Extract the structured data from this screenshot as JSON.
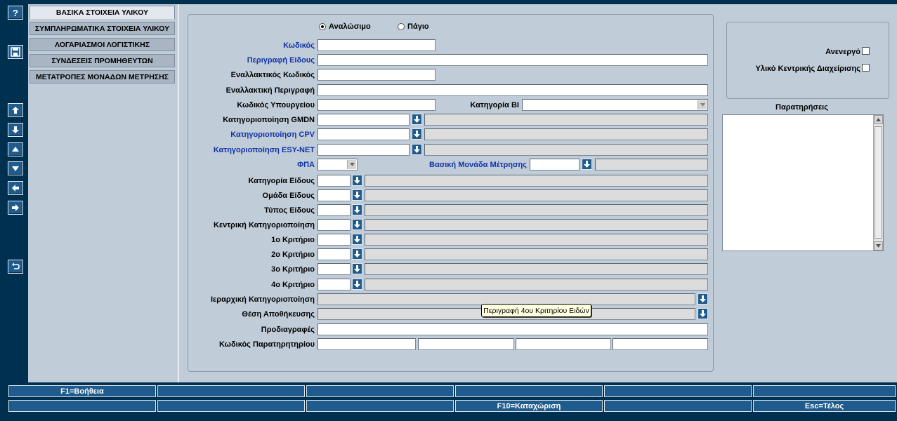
{
  "toolbar": {
    "help": "?",
    "icons": [
      "save-icon",
      "up-arrow-icon",
      "down-arrow-icon",
      "triangle-up-icon",
      "triangle-down-icon",
      "left-arrow-icon",
      "right-arrow-icon",
      "undo-icon"
    ]
  },
  "tabs": [
    "ΒΑΣΙΚΑ ΣΤΟΙΧΕΙΑ ΥΛΙΚΟΥ",
    "ΣΥΜΠΛΗΡΩΜΑΤΙΚΑ ΣΤΟΙΧΕΙΑ ΥΛΙΚΟΥ",
    "ΛΟΓΑΡΙΑΣΜΟΙ ΛΟΓΙΣΤΙΚΗΣ",
    "ΣΥΝΔΕΣΕΙΣ ΠΡΟΜΗΘΕΥΤΩΝ",
    "ΜΕΤΑΤΡΟΠΕΣ ΜΟΝΑΔΩΝ ΜΕΤΡΗΣΗΣ"
  ],
  "type": {
    "consumable": "Αναλώσιμο",
    "fixed": "Πάγιο",
    "selected": "Αναλώσιμο"
  },
  "form": {
    "code": "Κωδικός",
    "description": "Περιγραφή Είδους",
    "alt_code": "Εναλλακτικός Κωδικός",
    "alt_description": "Εναλλακτική Περιγραφή",
    "ministry_code": "Κωδικός Υπουργείου",
    "bi_category": "Κατηγορία BI",
    "gmdn": "Κατηγοριοποίηση GMDN",
    "cpv": "Κατηγοριοποίηση CPV",
    "esynet": "Κατηγοριοποίηση  ESY-NET",
    "vat": "ΦΠΑ",
    "base_unit": "Βασική Μονάδα Μέτρησης",
    "item_category": "Κατηγορία Είδους",
    "item_group": "Ομάδα Είδους",
    "item_type": "Τύπος Είδους",
    "central_class": "Κεντρική Κατηγοριοποίηση",
    "criterion1": "1ο Κριτήριο",
    "criterion2": "2ο Κριτήριο",
    "criterion3": "3ο Κριτήριο",
    "criterion4": "4ο Κριτήριο",
    "hierarchical": "Ιεραρχική Κατηγοριοποίηση",
    "storage": "Θέση Αποθήκευσης",
    "specs": "Προδιαγραφές",
    "observatory_code": "Κωδικός Παρατηρητηρίου"
  },
  "side": {
    "inactive": "Ανενεργό",
    "central_managed": "Υλικό Κεντρικής Διαχείρισης",
    "remarks": "Παρατηρήσεις"
  },
  "tooltip": "Περιγραφή 4ου Κριτηρίου Ειδών",
  "fkeys": {
    "row1": [
      "F1=Βοήθεια",
      "",
      "",
      "",
      "",
      ""
    ],
    "row2": [
      "",
      "",
      "",
      "F10=Καταχώριση",
      "",
      "Esc=Τέλος"
    ]
  },
  "colors": {
    "background": "#00304f",
    "panel": "#c0ccd8",
    "button": "#1f5b8c",
    "label_blue": "#1232a8"
  }
}
